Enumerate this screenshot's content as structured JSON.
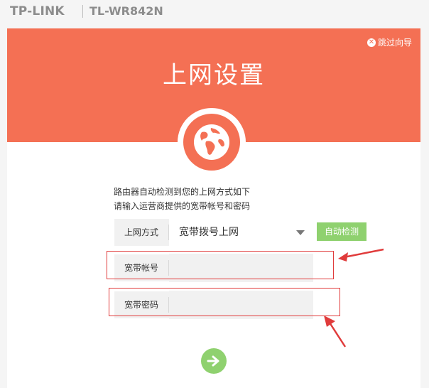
{
  "header": {
    "brand": "TP-LINK",
    "model": "TL-WR842N"
  },
  "hero": {
    "title": "上网设置",
    "skip_label": "跳过向导"
  },
  "intro": {
    "line1": "路由器自动检测到您的上网方式如下",
    "line2": "请输入运营商提供的宽带帐号和密码"
  },
  "form": {
    "connection_type_label": "上网方式",
    "connection_type_value": "宽带拨号上网",
    "auto_detect_label": "自动检测",
    "account_label": "宽带帐号",
    "account_value": "",
    "password_label": "宽带密码",
    "password_value": ""
  },
  "colors": {
    "hero": "#f47054",
    "accent_green": "#8fd16f",
    "annotation_red": "#e03b3b"
  },
  "icons": {
    "skip": "close-circle-icon",
    "globe": "globe-icon",
    "next": "arrow-right-icon"
  }
}
